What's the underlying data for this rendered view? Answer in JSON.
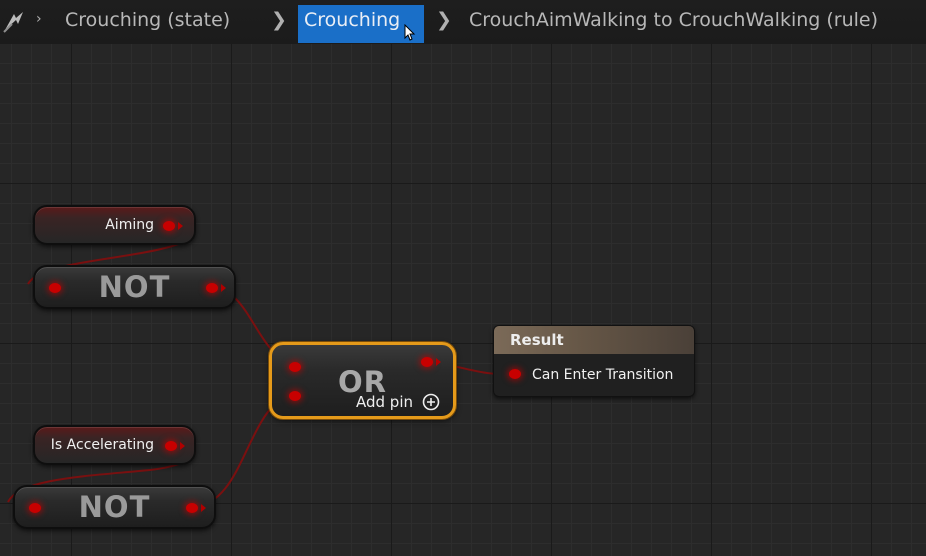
{
  "breadcrumb": {
    "items": [
      {
        "label": "Crouching (state)"
      },
      {
        "label": "Crouching"
      },
      {
        "label": "CrouchAimWalking to CrouchWalking (rule)"
      }
    ],
    "nav_icon": "blueprint-back-icon",
    "separator_icon": "chevron-right-icon"
  },
  "nodes": {
    "aiming": {
      "label": "Aiming"
    },
    "not_top": {
      "label": "NOT"
    },
    "is_accelerating": {
      "label": "Is Accelerating"
    },
    "not_bottom": {
      "label": "NOT"
    },
    "or": {
      "label": "OR",
      "add_pin_label": "Add pin",
      "add_pin_icon": "plus-circle-icon"
    },
    "result": {
      "title": "Result",
      "pin_label": "Can Enter Transition"
    }
  },
  "colors": {
    "accent": "#1a6fc8",
    "selected_outline": "#e59a1a",
    "bool_pin": "#c80000",
    "wire": "#8a1010"
  }
}
